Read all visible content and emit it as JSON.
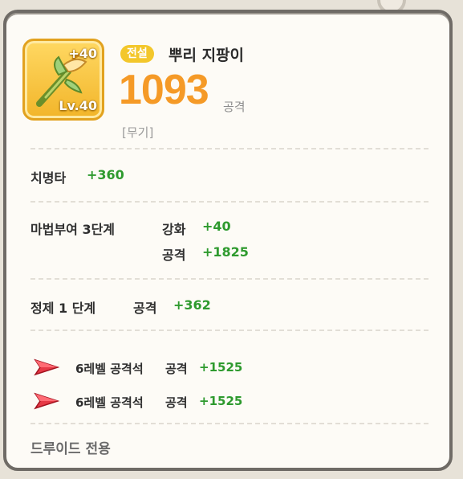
{
  "item": {
    "plus": "+40",
    "level": "Lv.40",
    "grade": "전설",
    "name": "뿌리 지팡이",
    "power": "1093",
    "power_label": "공격",
    "category": "[무기]"
  },
  "critical": {
    "label": "치명타",
    "value": "+360"
  },
  "enchant": {
    "label": "마법부여 3단계",
    "rows": [
      {
        "key": "강화",
        "value": "+40"
      },
      {
        "key": "공격",
        "value": "+1825"
      }
    ]
  },
  "refine": {
    "label": "정제 1 단계",
    "key": "공격",
    "value": "+362"
  },
  "gems": [
    {
      "icon": "red-gem-icon",
      "name": "6레벨 공격석",
      "key": "공격",
      "value": "+1525"
    },
    {
      "icon": "red-gem-icon",
      "name": "6레벨 공격석",
      "key": "공격",
      "value": "+1525"
    }
  ],
  "exclusive": "드루이드 전용",
  "colors": {
    "power": "#f59a27",
    "stat_green": "#2e9a2e",
    "grade_pill": "#f3c72b",
    "gem_red": "#e63946"
  }
}
